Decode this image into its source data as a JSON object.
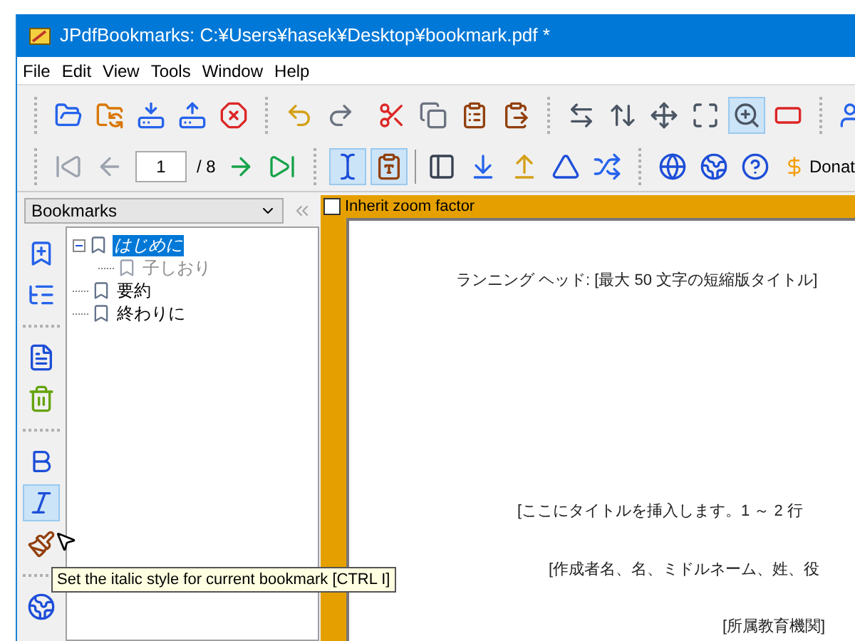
{
  "window": {
    "title": "JPdfBookmarks: C:¥Users¥hasek¥Desktop¥bookmark.pdf *"
  },
  "menu": [
    "File",
    "Edit",
    "View",
    "Tools",
    "Window",
    "Help"
  ],
  "toolbar_1": [
    {
      "selected": false
    },
    {
      "selected": false
    },
    {
      "selected": false
    },
    {
      "selected": false
    },
    {
      "selected": false
    },
    {
      "selected": false
    },
    {
      "selected": false
    },
    {
      "selected": false
    },
    {
      "selected": false
    },
    {
      "selected": false
    },
    {
      "selected": false
    },
    {
      "selected": false
    },
    {
      "selected": false
    },
    {
      "selected": false
    },
    {
      "selected": false
    },
    {
      "selected": true
    },
    {
      "selected": false
    },
    {
      "selected": false
    }
  ],
  "toolbar_2": {
    "page_value": "1",
    "page_total": "/ 8",
    "view_buttons": [
      {
        "selected": true
      },
      {
        "selected": true
      }
    ],
    "donate_label": "Donat"
  },
  "sidebar": {
    "dropdown": "Bookmarks",
    "tools": [
      {
        "selected": false
      },
      {
        "selected": false
      },
      {
        "selected": false
      },
      {
        "selected": false
      },
      {
        "selected": false
      },
      {
        "selected": true
      },
      {
        "selected": false
      },
      {
        "selected": false
      }
    ],
    "tree": [
      {
        "label": "はじめに",
        "selected": true,
        "italic": true,
        "disabled": false,
        "expanded": true,
        "children": [
          {
            "label": "子しおり",
            "selected": false,
            "italic": false,
            "disabled": true
          }
        ]
      },
      {
        "label": "要約",
        "selected": false,
        "italic": false,
        "disabled": false
      },
      {
        "label": "終わりに",
        "selected": false,
        "italic": false,
        "disabled": false
      }
    ]
  },
  "viewer": {
    "inherit_zoom": {
      "label": "Inherit zoom factor",
      "checked": false
    },
    "lines": [
      "ランニング ヘッド: [最大 50 文字の短縮版タイトル]",
      "[ここにタイトルを挿入します。1 ～ 2 行",
      "[作成者名、名、ミドルネーム、姓、役",
      "[所属教育機関]"
    ]
  },
  "tooltip": "Set the italic style for current bookmark [CTRL I]"
}
